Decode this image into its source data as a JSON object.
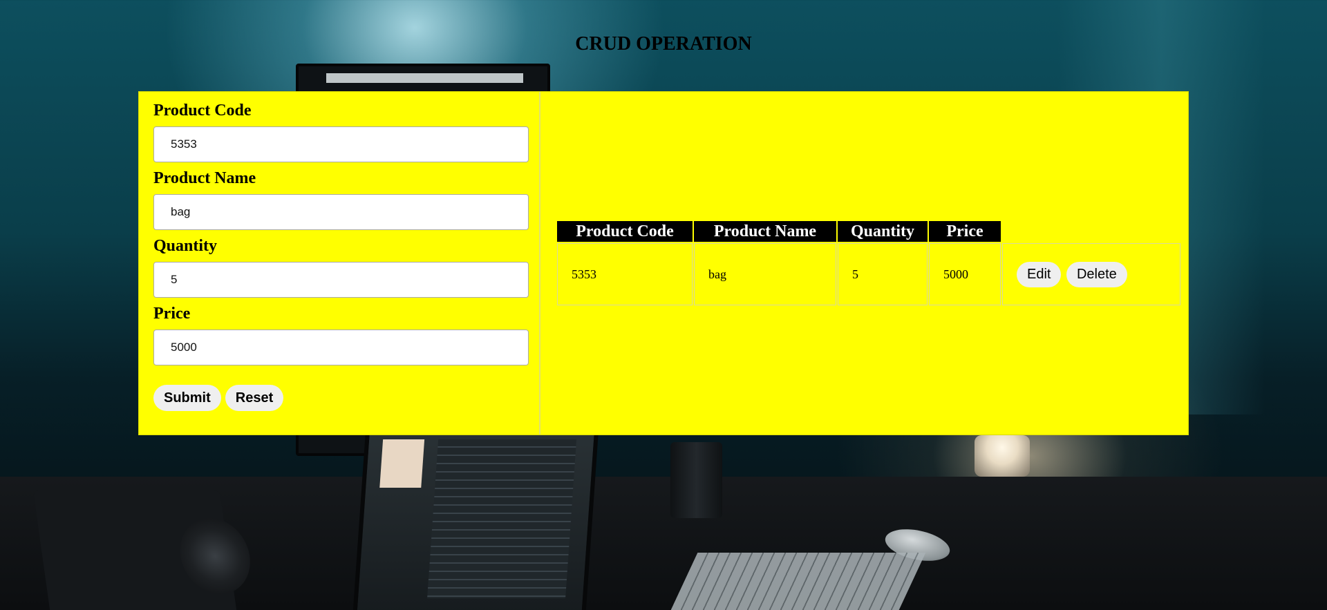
{
  "page": {
    "title": "CRUD OPERATION",
    "panel_color": "#ffff00"
  },
  "form": {
    "fields": [
      {
        "label": "Product Code",
        "value": "5353"
      },
      {
        "label": "Product Name",
        "value": "bag"
      },
      {
        "label": "Quantity",
        "value": "5"
      },
      {
        "label": "Price",
        "value": "5000"
      }
    ],
    "submit_label": "Submit",
    "reset_label": "Reset"
  },
  "table": {
    "headers": [
      "Product Code",
      "Product Name",
      "Quantity",
      "Price"
    ],
    "rows": [
      {
        "code": "5353",
        "name": "bag",
        "quantity": "5",
        "price": "5000",
        "edit_label": "Edit",
        "delete_label": "Delete"
      }
    ]
  }
}
